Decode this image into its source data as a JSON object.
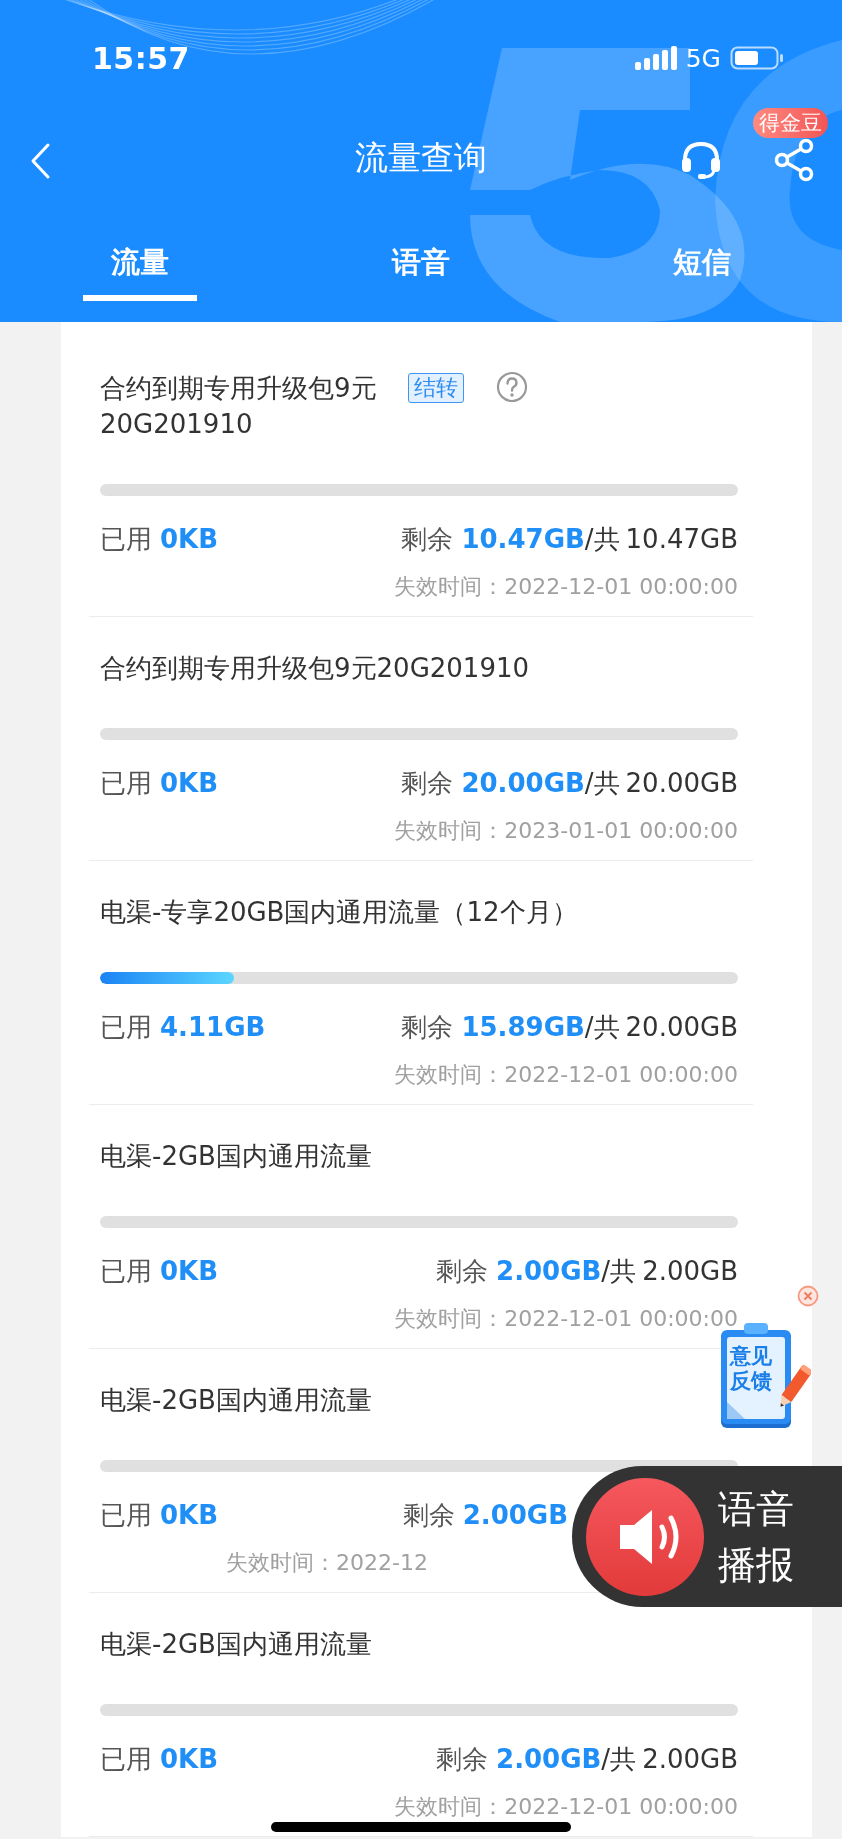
{
  "status_bar": {
    "time": "15:57",
    "network": "5G"
  },
  "nav": {
    "title": "流量查询",
    "badge": "得金豆"
  },
  "tabs": [
    {
      "label": "流量",
      "selected": true
    },
    {
      "label": "语音",
      "selected": false
    },
    {
      "label": "短信",
      "selected": false
    }
  ],
  "items": [
    {
      "title": "合约到期专用升级包9元20G201910",
      "tag": "结转",
      "help": true,
      "level": 0,
      "used_label": "已用",
      "used": "0KB",
      "remaining_label": "剩余",
      "remaining": "10.47GB",
      "total_label": "/共",
      "total": "10.47GB",
      "expiry": "失效时间：2022-12-01 00:00:00"
    },
    {
      "title": "合约到期专用升级包9元20G201910",
      "help": false,
      "level": 0,
      "used_label": "已用",
      "used": "0KB",
      "remaining_label": "剩余",
      "remaining": "20.00GB",
      "total_label": "/共",
      "total": "20.00GB",
      "expiry": "失效时间：2023-01-01 00:00:00"
    },
    {
      "title": "电渠-专享20GB国内通用流量（12个月）",
      "help": false,
      "level": 0.21,
      "used_label": "已用",
      "used": "4.11GB",
      "remaining_label": "剩余",
      "remaining": "15.89GB",
      "total_label": "/共",
      "total": "20.00GB",
      "expiry": "失效时间：2022-12-01 00:00:00"
    },
    {
      "title": "电渠-2GB国内通用流量",
      "help": false,
      "level": 0,
      "used_label": "已用",
      "used": "0KB",
      "remaining_label": "剩余",
      "remaining": "2.00GB",
      "total_label": "/共",
      "total": "2.00GB",
      "expiry": "失效时间：2022-12-01 00:00:00"
    },
    {
      "title": "电渠-2GB国内通用流量",
      "help": false,
      "level": 0,
      "used_label": "已用",
      "used": "0KB",
      "remaining_label": "剩余",
      "remaining": "2.00GB",
      "expiry": "失效时间：2022-12"
    },
    {
      "title": "电渠-2GB国内通用流量",
      "help": false,
      "level": 0,
      "used_label": "已用",
      "used": "0KB",
      "remaining_label": "剩余",
      "remaining": "2.00GB",
      "total_label": "/共",
      "total": "2.00GB",
      "expiry": "失效时间：2022-12-01 00:00:00"
    }
  ],
  "feedback": {
    "label": "意见反馈"
  },
  "voice_broadcast": {
    "label": "语音播报"
  }
}
